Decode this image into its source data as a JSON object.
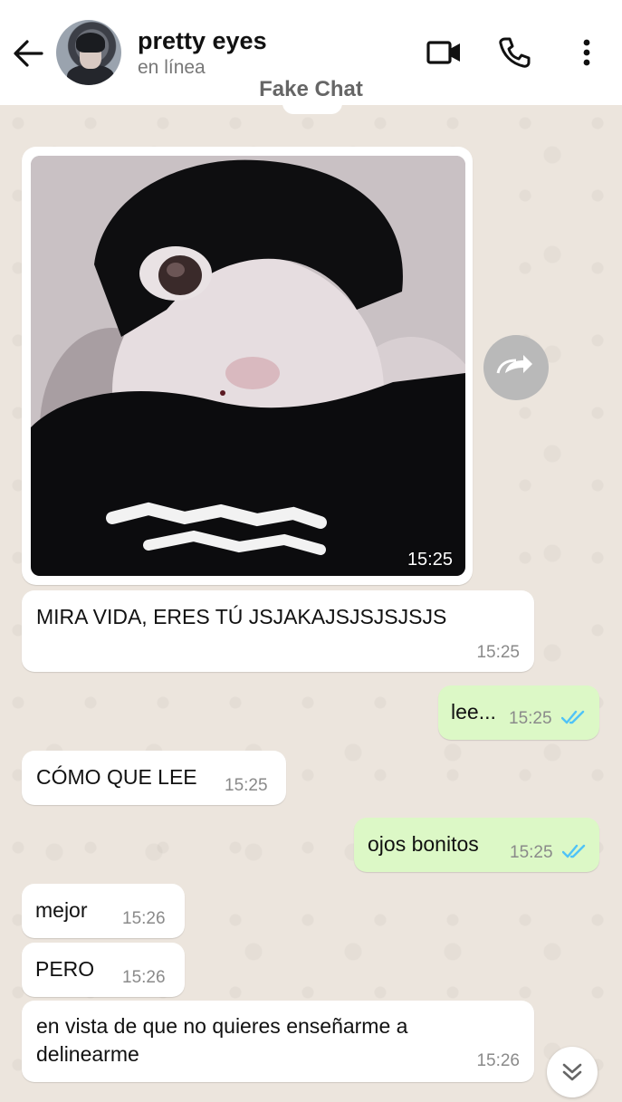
{
  "header": {
    "contact_name": "pretty eyes",
    "status": "en línea",
    "watermark": "Fake Chat",
    "icons": [
      "back-arrow-icon",
      "video-call-icon",
      "voice-call-icon",
      "more-options-icon"
    ]
  },
  "messages": [
    {
      "id": "m0",
      "direction": "incoming",
      "type": "image",
      "image_caption_time": "15:25"
    },
    {
      "id": "m1",
      "direction": "incoming",
      "text": "MIRA VIDA, ERES TÚ JSJAKAJSJSJSJSJS",
      "time": "15:25"
    },
    {
      "id": "m2",
      "direction": "outgoing",
      "text": "lee...",
      "time": "15:25",
      "status": "read"
    },
    {
      "id": "m3",
      "direction": "incoming",
      "text": "CÓMO QUE LEE",
      "time": "15:25"
    },
    {
      "id": "m4",
      "direction": "outgoing",
      "text": "ojos bonitos",
      "time": "15:25",
      "status": "read"
    },
    {
      "id": "m5",
      "direction": "incoming",
      "text": "mejor",
      "time": "15:26"
    },
    {
      "id": "m6",
      "direction": "incoming",
      "text": "PERO",
      "time": "15:26"
    },
    {
      "id": "m7",
      "direction": "incoming",
      "text_line1": "en vista de que no quieres enseñarme a",
      "text_line2": "delinearme",
      "time": "15:26"
    }
  ],
  "colors": {
    "header_bg": "#ffffff",
    "chat_bg": "#ece5dd",
    "incoming_bubble": "#ffffff",
    "outgoing_bubble": "#dcf8c6",
    "read_ticks": "#4fc3f7"
  }
}
